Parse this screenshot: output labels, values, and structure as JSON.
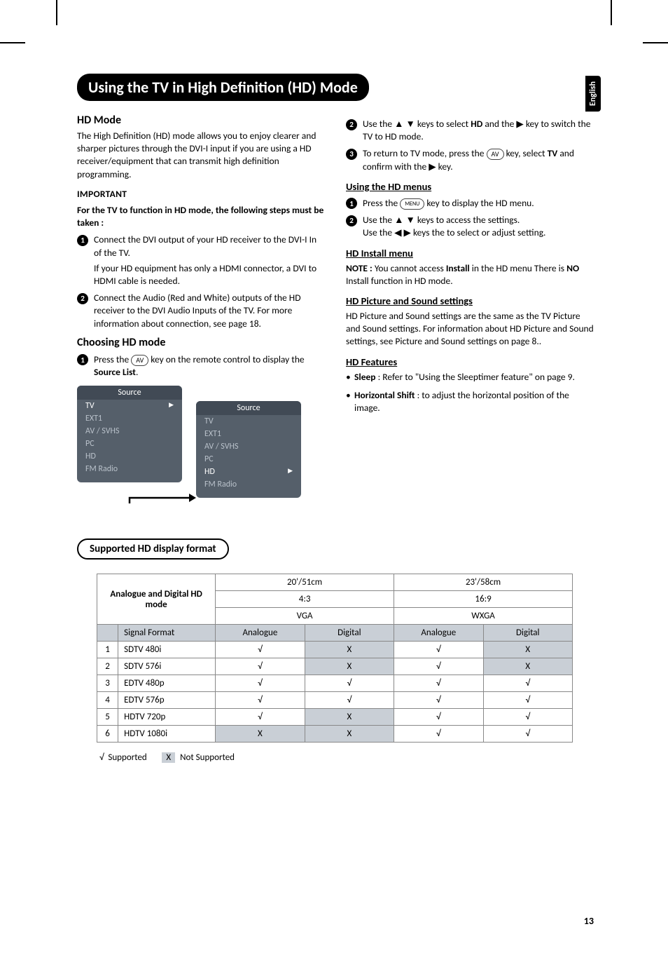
{
  "side_tab": "English",
  "title_bar": "Using the TV in High Definition (HD) Mode",
  "left": {
    "hd_mode_heading": "HD Mode",
    "hd_mode_para": "The High Definition (HD) mode allows you to enjoy clearer and sharper pictures through the DVI-I input if you are using a HD receiver/equipment that can transmit high definition programming.",
    "important_heading": "IMPORTANT",
    "important_intro": "For the TV to function in HD mode, the following steps must be taken :",
    "step1a": "Connect the DVI output of your HD receiver to the DVI-I In of the TV.",
    "step1b": "If your HD equipment has only a HDMI connector, a DVI to HDMI cable is needed.",
    "step2": "Connect the Audio (Red and White) outputs of the HD receiver to the DVI Audio Inputs of the TV. For more information about connection, see page 18.",
    "choosing_heading": "Choosing HD mode",
    "choose_step1_pre": "Press the ",
    "choose_step1_key": "AV",
    "choose_step1_post": " key on the remote control to display the ",
    "choose_step1_bold": "Source List",
    "choose_step1_end": ".",
    "source_panel": {
      "header": "Source",
      "items": [
        "TV",
        "EXT1",
        "AV / SVHS",
        "PC",
        "HD",
        "FM Radio"
      ],
      "selected_left": "TV",
      "selected_right_index": 4
    }
  },
  "right": {
    "r_step2_pre": "Use the ▲ ▼ keys to select ",
    "r_step2_bold": "HD",
    "r_step2_mid": " and the ▶ key to ",
    "r_step2_post": "switch the TV to HD mode.",
    "r_step3_pre": "To return to TV mode, press the ",
    "r_step3_key": "AV",
    "r_step3_mid": " key, select ",
    "r_step3_bold": "TV",
    "r_step3_post": " and confirm with the  ▶  key.",
    "using_hd_menus": "Using the HD menus",
    "hd_menu_step1_pre": "Press the ",
    "hd_menu_step1_key": "MENU",
    "hd_menu_step1_post": " key to display the HD menu.",
    "hd_menu_step2a": "Use the ▲ ▼ keys to access the settings.",
    "hd_menu_step2b": "Use the ◀  ▶   keys the to select or adjust setting.",
    "hd_install_heading": "HD Install menu",
    "hd_install_note_pre": "NOTE : ",
    "hd_install_note_body1": "You cannot access ",
    "hd_install_note_bold1": "Install",
    "hd_install_note_body2": " in the HD menu There is ",
    "hd_install_note_bold2": "NO",
    "hd_install_note_body3": " Install function in HD mode.",
    "hd_pic_sound_heading": "HD Picture and Sound settings",
    "hd_pic_sound_para": "HD Picture and Sound settings are the same as the TV Picture and Sound settings. For information about HD Picture and Sound settings, see Picture and Sound settings on page 8..",
    "hd_features_heading": "HD Features",
    "feature1_bold": "Sleep",
    "feature1_rest": " : Refer to \"Using the Sleeptimer feature\" on page 9.",
    "feature2_bold": "Horizontal Shift",
    "feature2_rest": " : to adjust the horizontal position of the image."
  },
  "pill_label": "Supported HD display format",
  "table": {
    "row_header": "Analogue and Digital HD mode",
    "size1": "20'/51cm",
    "size2": "23'/58cm",
    "ar1": "4:3",
    "ar2": "16:9",
    "res1": "VGA",
    "res2": "WXGA",
    "col_sf": "Signal Format",
    "col_a": "Analogue",
    "col_d": "Digital",
    "rows": [
      {
        "n": "1",
        "name": "SDTV 480i",
        "a1": "√",
        "d1": "X",
        "a2": "√",
        "d2": "X"
      },
      {
        "n": "2",
        "name": "SDTV 576i",
        "a1": "√",
        "d1": "X",
        "a2": "√",
        "d2": "X"
      },
      {
        "n": "3",
        "name": "EDTV 480p",
        "a1": "√",
        "d1": "√",
        "a2": "√",
        "d2": "√"
      },
      {
        "n": "4",
        "name": "EDTV 576p",
        "a1": "√",
        "d1": "√",
        "a2": "√",
        "d2": "√"
      },
      {
        "n": "5",
        "name": "HDTV 720p",
        "a1": "√",
        "d1": "X",
        "a2": "√",
        "d2": "√"
      },
      {
        "n": "6",
        "name": "HDTV 1080i",
        "a1": "X",
        "d1": "X",
        "a2": "√",
        "d2": "√"
      }
    ]
  },
  "legend_supported": "Supported",
  "legend_not": "Not Supported",
  "legend_check": "√",
  "legend_x": "X",
  "page_number": "13"
}
